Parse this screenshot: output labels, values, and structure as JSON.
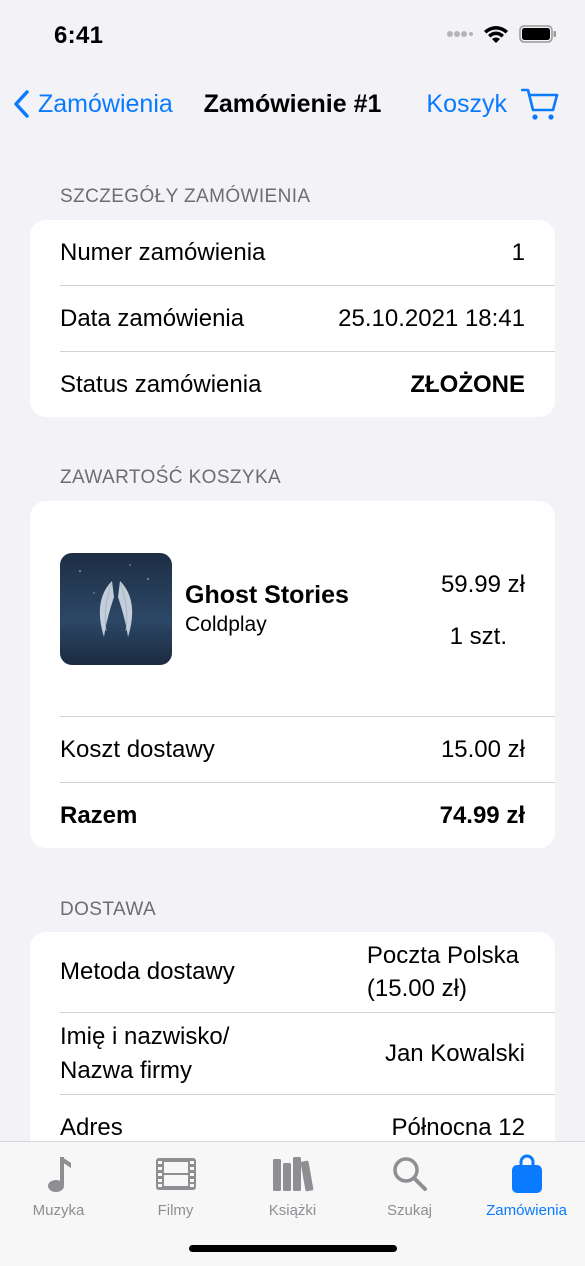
{
  "status_bar": {
    "time": "6:41"
  },
  "nav": {
    "back_label": "Zamówienia",
    "title": "Zamówienie #1",
    "cart_label": "Koszyk"
  },
  "order_details": {
    "header": "SZCZEGÓŁY ZAMÓWIENIA",
    "rows": [
      {
        "label": "Numer zamówienia",
        "value": "1"
      },
      {
        "label": "Data zamówienia",
        "value": "25.10.2021 18:41"
      },
      {
        "label": "Status zamówienia",
        "value": "ZŁOŻONE"
      }
    ]
  },
  "cart": {
    "header": "ZAWARTOŚĆ KOSZYKA",
    "item": {
      "title": "Ghost Stories",
      "artist": "Coldplay",
      "price": "59.99 zł",
      "quantity": "1 szt."
    },
    "shipping_label": "Koszt dostawy",
    "shipping_value": "15.00 zł",
    "total_label": "Razem",
    "total_value": "74.99 zł"
  },
  "delivery": {
    "header": "DOSTAWA",
    "method_label": "Metoda dostawy",
    "method_value_line1": "Poczta Polska",
    "method_value_line2": "(15.00 zł)",
    "name_label_line1": "Imię i nazwisko/",
    "name_label_line2": "Nazwa firmy",
    "name_value": "Jan Kowalski",
    "address_label": "Adres",
    "address_value": "Północna 12"
  },
  "tabs": [
    {
      "label": "Muzyka",
      "icon": "music-note-icon"
    },
    {
      "label": "Filmy",
      "icon": "film-icon"
    },
    {
      "label": "Książki",
      "icon": "books-icon"
    },
    {
      "label": "Szukaj",
      "icon": "search-icon"
    },
    {
      "label": "Zamówienia",
      "icon": "bag-icon",
      "active": true
    }
  ],
  "colors": {
    "accent": "#0a7aff",
    "background": "#f2f2f7",
    "inactive": "#8e8e93"
  }
}
